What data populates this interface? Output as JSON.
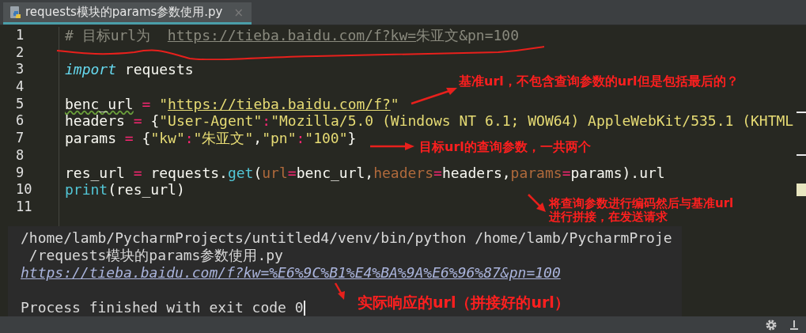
{
  "tab": {
    "title": "requests模块的params参数使用.py",
    "close": "×",
    "selected": true
  },
  "editor": {
    "lines": [
      {
        "number": "1",
        "tokens": [
          {
            "kind": "comment",
            "text": "# 目标url为  "
          },
          {
            "kind": "comment-link",
            "text": "https://tieba.baidu.com/f?kw="
          },
          {
            "kind": "comment",
            "text": "朱亚文&pn=100"
          }
        ]
      },
      {
        "number": "2"
      },
      {
        "number": "3",
        "tokens": [
          {
            "kind": "keyword",
            "text": "import"
          },
          {
            "kind": "plain",
            "text": " requests"
          }
        ]
      },
      {
        "number": "4"
      },
      {
        "number": "5",
        "tokens": [
          {
            "kind": "warn",
            "text": "benc_url"
          },
          {
            "kind": "op",
            "text": " = "
          },
          {
            "kind": "string",
            "text": "\""
          },
          {
            "kind": "string-link",
            "text": "https://tieba.baidu.com/f?"
          },
          {
            "kind": "string",
            "text": "\""
          }
        ]
      },
      {
        "number": "6",
        "tokens": [
          {
            "kind": "plain",
            "text": "headers "
          },
          {
            "kind": "op",
            "text": "="
          },
          {
            "kind": "plain",
            "text": " {"
          },
          {
            "kind": "string",
            "text": "\"User-Agent\""
          },
          {
            "kind": "op",
            "text": ":"
          },
          {
            "kind": "string",
            "text": "\"Mozilla/5.0 (Windows NT 6.1; WOW64) AppleWebKit/535.1 (KHTML"
          }
        ]
      },
      {
        "number": "7",
        "tokens": [
          {
            "kind": "plain",
            "text": "params "
          },
          {
            "kind": "op",
            "text": "="
          },
          {
            "kind": "plain",
            "text": " {"
          },
          {
            "kind": "string",
            "text": "\"kw\""
          },
          {
            "kind": "op",
            "text": ":"
          },
          {
            "kind": "string",
            "text": "\"朱亚文\""
          },
          {
            "kind": "plain",
            "text": ","
          },
          {
            "kind": "string",
            "text": "\"pn\""
          },
          {
            "kind": "op",
            "text": ":"
          },
          {
            "kind": "string",
            "text": "\"100\""
          },
          {
            "kind": "plain",
            "text": "}"
          }
        ]
      },
      {
        "number": "8"
      },
      {
        "number": "9",
        "tokens": [
          {
            "kind": "plain",
            "text": "res_url "
          },
          {
            "kind": "op",
            "text": "="
          },
          {
            "kind": "plain",
            "text": " requests."
          },
          {
            "kind": "func",
            "text": "get"
          },
          {
            "kind": "plain",
            "text": "("
          },
          {
            "kind": "param",
            "text": "url"
          },
          {
            "kind": "op",
            "text": "="
          },
          {
            "kind": "plain",
            "text": "benc_url,"
          },
          {
            "kind": "param",
            "text": "headers"
          },
          {
            "kind": "op",
            "text": "="
          },
          {
            "kind": "plain",
            "text": "headers,"
          },
          {
            "kind": "param",
            "text": "params"
          },
          {
            "kind": "op",
            "text": "="
          },
          {
            "kind": "plain",
            "text": "params).url"
          }
        ]
      },
      {
        "number": "10",
        "tokens": [
          {
            "kind": "func",
            "text": "print"
          },
          {
            "kind": "plain",
            "text": "(res_url)"
          }
        ]
      },
      {
        "number": "11"
      }
    ]
  },
  "run_output": {
    "lines": [
      {
        "kind": "plain",
        "text": "/home/lamb/PycharmProjects/untitled4/venv/bin/python /home/lamb/PycharmProje"
      },
      {
        "kind": "plain",
        "text": " /requests模块的params参数使用.py"
      },
      {
        "kind": "link",
        "text": "https://tieba.baidu.com/f?kw=%E6%9C%B1%E4%BA%9A%E6%96%87&pn=100"
      },
      {
        "kind": "blank"
      },
      {
        "kind": "plain",
        "text": "Process finished with exit code 0",
        "cursor": true
      }
    ]
  },
  "annotations": [
    {
      "lines": [
        "基准url，不包含查询参数的url但是包括最后的？"
      ]
    },
    {
      "lines": [
        "目标url的查询参数，一共两个"
      ]
    },
    {
      "lines": [
        "将查询参数进行编码然后与基准url",
        "进行拼接，在发送请求"
      ]
    },
    {
      "lines": [
        "实际响应的url（拼接好的url）"
      ]
    }
  ]
}
